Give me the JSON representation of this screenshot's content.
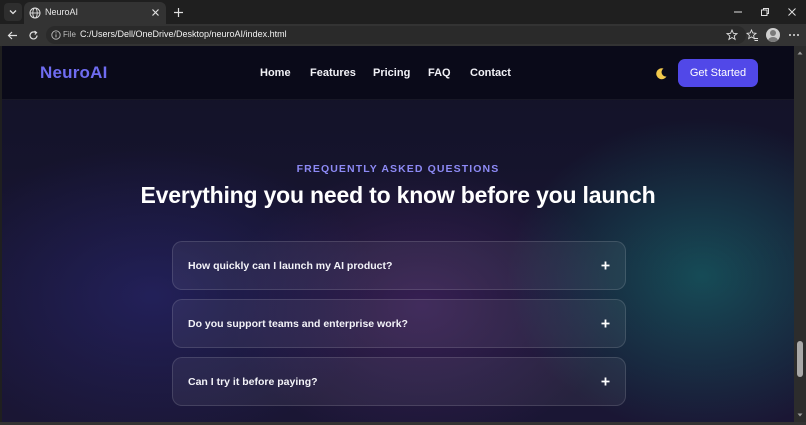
{
  "browser": {
    "tab_title": "NeuroAI",
    "url_scheme_label": "File",
    "url": "C:/Users/Dell/OneDrive/Desktop/neuroAI/index.html"
  },
  "site": {
    "brand": "NeuroAI",
    "nav": [
      "Home",
      "Features",
      "Pricing",
      "FAQ",
      "Contact"
    ],
    "cta_label": "Get Started",
    "accent": "#5148e8"
  },
  "faq_section": {
    "eyebrow": "FREQUENTLY ASKED QUESTIONS",
    "headline": "Everything you need to know before you launch",
    "items": [
      {
        "question": "How quickly can I launch my AI product?"
      },
      {
        "question": "Do you support teams and enterprise work?"
      },
      {
        "question": "Can I try it before paying?"
      }
    ]
  }
}
